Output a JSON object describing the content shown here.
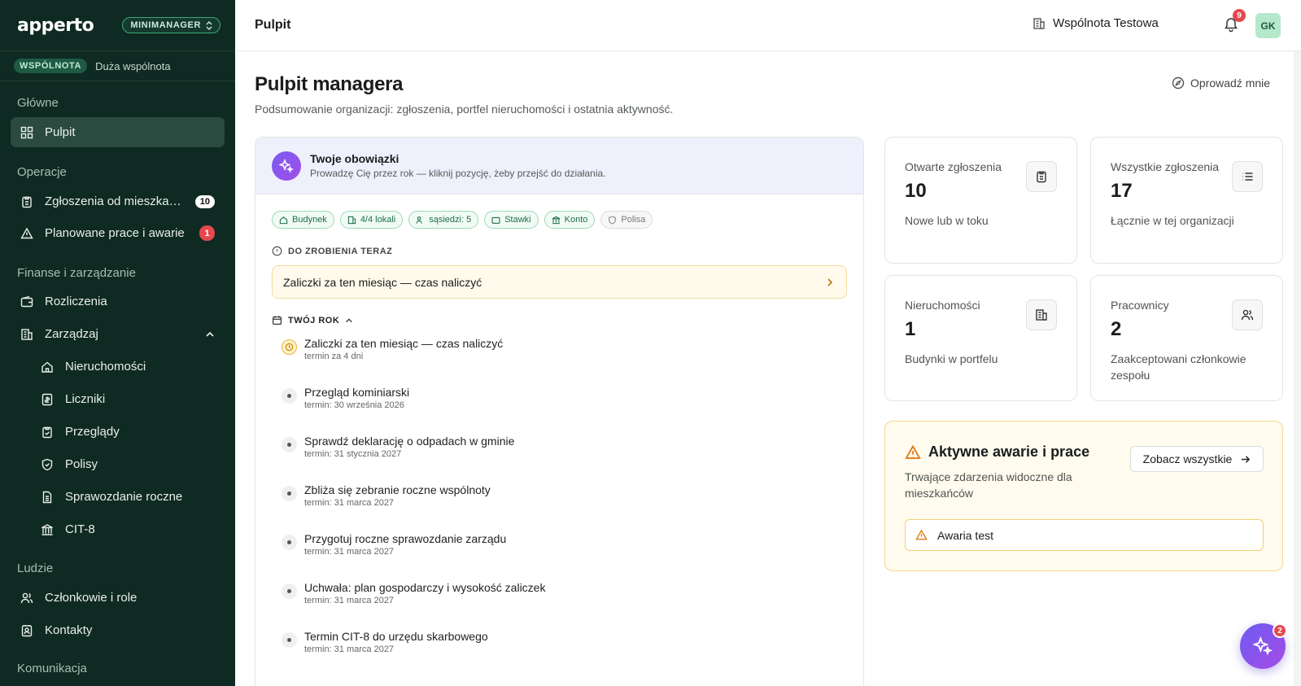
{
  "brand": {
    "logo_text": "apperto",
    "mode_label": "MINIMANAGER"
  },
  "org": {
    "badge": "WSPÓLNOTA",
    "name": "Duża wspólnota"
  },
  "sidebar": {
    "sections": {
      "main": "Główne",
      "operations": "Operacje",
      "finance": "Finanse i zarządzanie",
      "people": "Ludzie",
      "communication": "Komunikacja"
    },
    "items": {
      "dashboard": "Pulpit",
      "reports": "Zgłoszenia od mieszkańców",
      "reports_count": "10",
      "planned_works": "Planowane prace i awarie",
      "planned_count": "1",
      "settlements": "Rozliczenia",
      "manage": "Zarządzaj",
      "properties": "Nieruchomości",
      "meters": "Liczniki",
      "inspections": "Przeglądy",
      "policies": "Polisy",
      "annual_report": "Sprawozdanie roczne",
      "cit8": "CIT-8",
      "members": "Członkowie i role",
      "contacts": "Kontakty"
    }
  },
  "topbar": {
    "title": "Pulpit",
    "org_switch": "Wspólnota Testowa",
    "notifications_count": "9",
    "avatar_initials": "GK"
  },
  "page": {
    "title": "Pulpit managera",
    "subtitle": "Podsumowanie organizacji: zgłoszenia, portfel nieruchomości i ostatnia aktywność.",
    "tour_label": "Oprowadź mnie"
  },
  "duties": {
    "title": "Twoje obowiązki",
    "subtitle": "Prowadzę Cię przez rok — kliknij pozycję, żeby przejść do działania.",
    "chips": [
      "Budynek",
      "4/4 lokali",
      "sąsiedzi: 5",
      "Stawki",
      "Konto",
      "Polisa"
    ],
    "todo_label": "DO ZROBIENIA TERAZ",
    "todo_item": "Zaliczki za ten miesiąc — czas naliczyć",
    "year_label": "TWÓJ ROK",
    "year_items": [
      {
        "title": "Zaliczki za ten miesiąc — czas naliczyć",
        "due": "termin za 4 dni"
      },
      {
        "title": "Przegląd kominiarski",
        "due": "termin: 30 września 2026"
      },
      {
        "title": "Sprawdź deklarację o odpadach w gminie",
        "due": "termin: 31 stycznia 2027"
      },
      {
        "title": "Zbliża się zebranie roczne wspólnoty",
        "due": "termin: 31 marca 2027"
      },
      {
        "title": "Przygotuj roczne sprawozdanie zarządu",
        "due": "termin: 31 marca 2027"
      },
      {
        "title": "Uchwała: plan gospodarczy i wysokość zaliczek",
        "due": "termin: 31 marca 2027"
      },
      {
        "title": "Termin CIT-8 do urzędu skarbowego",
        "due": "termin: 31 marca 2027"
      }
    ]
  },
  "stats": {
    "open": {
      "label": "Otwarte zgłoszenia",
      "value": "10",
      "desc": "Nowe lub w toku"
    },
    "all": {
      "label": "Wszystkie zgłoszenia",
      "value": "17",
      "desc": "Łącznie w tej organizacji"
    },
    "properties": {
      "label": "Nieruchomości",
      "value": "1",
      "desc": "Budynki w portfelu"
    },
    "staff": {
      "label": "Pracownicy",
      "value": "2",
      "desc": "Zaakceptowani członkowie zespołu"
    }
  },
  "alerts": {
    "title": "Aktywne awarie i prace",
    "subtitle": "Trwające zdarzenia widoczne dla mieszkańców",
    "see_all": "Zobacz wszystkie",
    "items": [
      "Awaria test"
    ]
  },
  "fab": {
    "badge": "2"
  },
  "colors": {
    "sidebar_bg": "#0f2a22",
    "accent": "#3fa77a",
    "warning": "#e39a1f",
    "danger": "#e5484d",
    "assistant": "#7a5cf0"
  }
}
